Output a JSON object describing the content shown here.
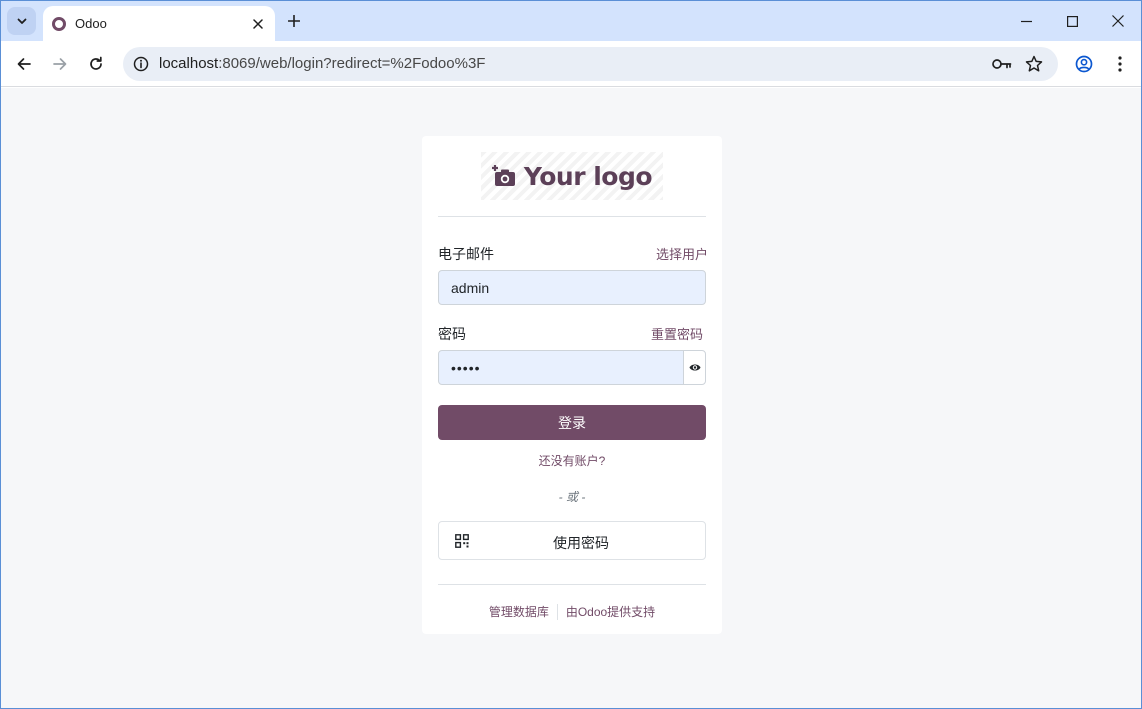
{
  "browser": {
    "tab_title": "Odoo",
    "url_host": "localhost",
    "url_rest": ":8069/web/login?redirect=%2Fodoo%3F"
  },
  "login": {
    "logo_text": "Your logo",
    "email_label": "电子邮件",
    "select_user_link": "选择用户",
    "email_value": "admin",
    "password_label": "密码",
    "reset_password_link": "重置密码",
    "password_mask": "•••••",
    "login_button": "登录",
    "signup_link": "还没有账户?",
    "or_text": "- 或 -",
    "passkey_button": "使用密码"
  },
  "footer": {
    "manage_db": "管理数据库",
    "powered_by": "由Odoo提供支持"
  },
  "colors": {
    "brand": "#714b67",
    "tabbar": "#d3e3fd",
    "page_bg": "#f6f7f9"
  }
}
